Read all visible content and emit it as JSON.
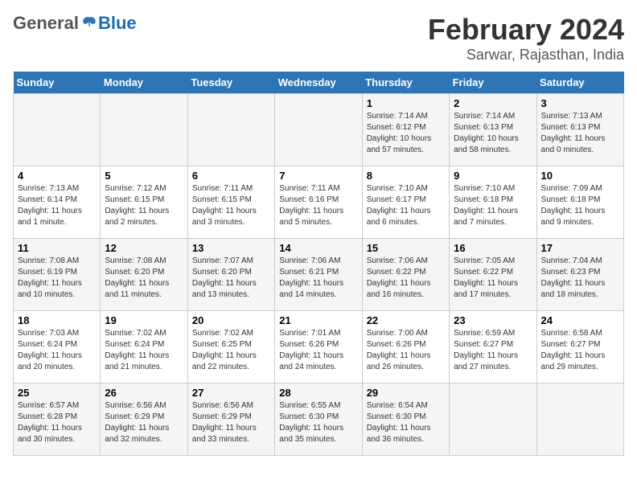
{
  "logo": {
    "general": "General",
    "blue": "Blue"
  },
  "title": "February 2024",
  "subtitle": "Sarwar, Rajasthan, India",
  "days_of_week": [
    "Sunday",
    "Monday",
    "Tuesday",
    "Wednesday",
    "Thursday",
    "Friday",
    "Saturday"
  ],
  "weeks": [
    [
      {
        "num": "",
        "info": ""
      },
      {
        "num": "",
        "info": ""
      },
      {
        "num": "",
        "info": ""
      },
      {
        "num": "",
        "info": ""
      },
      {
        "num": "1",
        "info": "Sunrise: 7:14 AM\nSunset: 6:12 PM\nDaylight: 10 hours\nand 57 minutes."
      },
      {
        "num": "2",
        "info": "Sunrise: 7:14 AM\nSunset: 6:13 PM\nDaylight: 10 hours\nand 58 minutes."
      },
      {
        "num": "3",
        "info": "Sunrise: 7:13 AM\nSunset: 6:13 PM\nDaylight: 11 hours\nand 0 minutes."
      }
    ],
    [
      {
        "num": "4",
        "info": "Sunrise: 7:13 AM\nSunset: 6:14 PM\nDaylight: 11 hours\nand 1 minute."
      },
      {
        "num": "5",
        "info": "Sunrise: 7:12 AM\nSunset: 6:15 PM\nDaylight: 11 hours\nand 2 minutes."
      },
      {
        "num": "6",
        "info": "Sunrise: 7:11 AM\nSunset: 6:15 PM\nDaylight: 11 hours\nand 3 minutes."
      },
      {
        "num": "7",
        "info": "Sunrise: 7:11 AM\nSunset: 6:16 PM\nDaylight: 11 hours\nand 5 minutes."
      },
      {
        "num": "8",
        "info": "Sunrise: 7:10 AM\nSunset: 6:17 PM\nDaylight: 11 hours\nand 6 minutes."
      },
      {
        "num": "9",
        "info": "Sunrise: 7:10 AM\nSunset: 6:18 PM\nDaylight: 11 hours\nand 7 minutes."
      },
      {
        "num": "10",
        "info": "Sunrise: 7:09 AM\nSunset: 6:18 PM\nDaylight: 11 hours\nand 9 minutes."
      }
    ],
    [
      {
        "num": "11",
        "info": "Sunrise: 7:08 AM\nSunset: 6:19 PM\nDaylight: 11 hours\nand 10 minutes."
      },
      {
        "num": "12",
        "info": "Sunrise: 7:08 AM\nSunset: 6:20 PM\nDaylight: 11 hours\nand 11 minutes."
      },
      {
        "num": "13",
        "info": "Sunrise: 7:07 AM\nSunset: 6:20 PM\nDaylight: 11 hours\nand 13 minutes."
      },
      {
        "num": "14",
        "info": "Sunrise: 7:06 AM\nSunset: 6:21 PM\nDaylight: 11 hours\nand 14 minutes."
      },
      {
        "num": "15",
        "info": "Sunrise: 7:06 AM\nSunset: 6:22 PM\nDaylight: 11 hours\nand 16 minutes."
      },
      {
        "num": "16",
        "info": "Sunrise: 7:05 AM\nSunset: 6:22 PM\nDaylight: 11 hours\nand 17 minutes."
      },
      {
        "num": "17",
        "info": "Sunrise: 7:04 AM\nSunset: 6:23 PM\nDaylight: 11 hours\nand 18 minutes."
      }
    ],
    [
      {
        "num": "18",
        "info": "Sunrise: 7:03 AM\nSunset: 6:24 PM\nDaylight: 11 hours\nand 20 minutes."
      },
      {
        "num": "19",
        "info": "Sunrise: 7:02 AM\nSunset: 6:24 PM\nDaylight: 11 hours\nand 21 minutes."
      },
      {
        "num": "20",
        "info": "Sunrise: 7:02 AM\nSunset: 6:25 PM\nDaylight: 11 hours\nand 22 minutes."
      },
      {
        "num": "21",
        "info": "Sunrise: 7:01 AM\nSunset: 6:26 PM\nDaylight: 11 hours\nand 24 minutes."
      },
      {
        "num": "22",
        "info": "Sunrise: 7:00 AM\nSunset: 6:26 PM\nDaylight: 11 hours\nand 26 minutes."
      },
      {
        "num": "23",
        "info": "Sunrise: 6:59 AM\nSunset: 6:27 PM\nDaylight: 11 hours\nand 27 minutes."
      },
      {
        "num": "24",
        "info": "Sunrise: 6:58 AM\nSunset: 6:27 PM\nDaylight: 11 hours\nand 29 minutes."
      }
    ],
    [
      {
        "num": "25",
        "info": "Sunrise: 6:57 AM\nSunset: 6:28 PM\nDaylight: 11 hours\nand 30 minutes."
      },
      {
        "num": "26",
        "info": "Sunrise: 6:56 AM\nSunset: 6:29 PM\nDaylight: 11 hours\nand 32 minutes."
      },
      {
        "num": "27",
        "info": "Sunrise: 6:56 AM\nSunset: 6:29 PM\nDaylight: 11 hours\nand 33 minutes."
      },
      {
        "num": "28",
        "info": "Sunrise: 6:55 AM\nSunset: 6:30 PM\nDaylight: 11 hours\nand 35 minutes."
      },
      {
        "num": "29",
        "info": "Sunrise: 6:54 AM\nSunset: 6:30 PM\nDaylight: 11 hours\nand 36 minutes."
      },
      {
        "num": "",
        "info": ""
      },
      {
        "num": "",
        "info": ""
      }
    ]
  ]
}
